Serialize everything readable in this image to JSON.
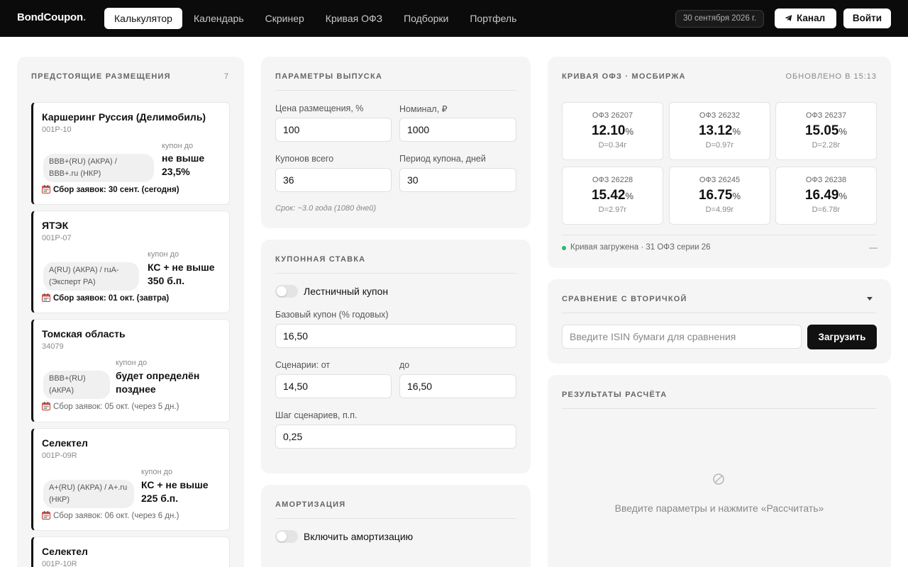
{
  "brand": {
    "name": "BondCoupon",
    "dot": "."
  },
  "nav": [
    {
      "label": "Калькулятор",
      "active": true
    },
    {
      "label": "Календарь"
    },
    {
      "label": "Скринер"
    },
    {
      "label": "Кривая ОФЗ"
    },
    {
      "label": "Подборки"
    },
    {
      "label": "Портфель"
    }
  ],
  "header": {
    "date": "30 сентября 2026 г.",
    "channel_label": "Канал",
    "channel_icon": "telegram-icon",
    "login_label": "Войти"
  },
  "upcoming": {
    "title": "ПРЕДСТОЯЩИЕ РАЗМЕЩЕНИЯ",
    "count": "7",
    "items": [
      {
        "name": "Каршеринг Руссия (Делимобиль)",
        "code": "001P-10",
        "rating": "BBB+(RU) (АКРА) / BBB+.ru (НКР)",
        "coupon_label": "купон до",
        "coupon": "не выше 23,5%",
        "book": "Сбор заявок: 30 сент. (сегодня)"
      },
      {
        "name": "ЯТЭК",
        "code": "001P-07",
        "rating": "A(RU) (АКРА) / ruA- (Эксперт РА)",
        "coupon_label": "купон до",
        "coupon": "КС + не выше 350 б.п.",
        "book": "Сбор заявок: 01 окт. (завтра)"
      },
      {
        "name": "Томская область",
        "code": "34079",
        "rating": "BBB+(RU) (АКРА)",
        "coupon_label": "купон до",
        "coupon": "будет определён позднее",
        "book": "Сбор заявок: 05 окт. (через 5 дн.)"
      },
      {
        "name": "Селектел",
        "code": "001P-09R",
        "rating": "A+(RU) (АКРА) / A+.ru (НКР)",
        "coupon_label": "купон до",
        "coupon": "КС + не выше 225 б.п.",
        "book": "Сбор заявок: 06 окт. (через 6 дн.)"
      },
      {
        "name": "Селектел",
        "code": "001P-10R"
      }
    ]
  },
  "issue_params": {
    "title": "ПАРАМЕТРЫ ВЫПУСКА",
    "price_label": "Цена размещения, %",
    "price_value": "100",
    "nominal_label": "Номинал, ₽",
    "nominal_value": "1000",
    "coupons_label": "Купонов всего",
    "coupons_value": "36",
    "period_label": "Период купона, дней",
    "period_value": "30",
    "term_hint": "Срок: ~3.0 года (1080 дней)"
  },
  "coupon_rate": {
    "title": "КУПОННАЯ СТАВКА",
    "ladder_label": "Лестничный купон",
    "ladder_on": false,
    "base_label": "Базовый купон (% годовых)",
    "base_value": "16,50",
    "from_label": "Сценарии: от",
    "from_value": "14,50",
    "to_label": "до",
    "to_value": "16,50",
    "step_label": "Шаг сценариев, п.п.",
    "step_value": "0,25"
  },
  "amortization": {
    "title": "АМОРТИЗАЦИЯ",
    "toggle_label": "Включить амортизацию",
    "on": false
  },
  "ofz_curve": {
    "title": "КРИВАЯ ОФЗ · МОСБИРЖА",
    "updated": "ОБНОВЛЕНО В 15:13",
    "bonds": [
      {
        "name": "ОФЗ 26207",
        "yield": "12.10",
        "unit": "%",
        "duration": "D=0.34г"
      },
      {
        "name": "ОФЗ 26232",
        "yield": "13.12",
        "unit": "%",
        "duration": "D=0.97г"
      },
      {
        "name": "ОФЗ 26237",
        "yield": "15.05",
        "unit": "%",
        "duration": "D=2.28г"
      },
      {
        "name": "ОФЗ 26228",
        "yield": "15.42",
        "unit": "%",
        "duration": "D=2.97г"
      },
      {
        "name": "ОФЗ 26245",
        "yield": "16.75",
        "unit": "%",
        "duration": "D=4.99г"
      },
      {
        "name": "ОФЗ 26238",
        "yield": "16.49",
        "unit": "%",
        "duration": "D=6.78г"
      }
    ],
    "status": "Кривая загружена · 31 ОФЗ серии 26",
    "status_right": "—",
    "status_color": "#2bb673"
  },
  "compare": {
    "title": "СРАВНЕНИЕ С ВТОРИЧКОЙ",
    "placeholder": "Введите ISIN бумаги для сравнения",
    "load_label": "Загрузить"
  },
  "results": {
    "title": "РЕЗУЛЬТАТЫ РАСЧЁТА",
    "empty_text": "Введите параметры и нажмите «Рассчитать»",
    "empty_icon": "no-results-icon"
  }
}
